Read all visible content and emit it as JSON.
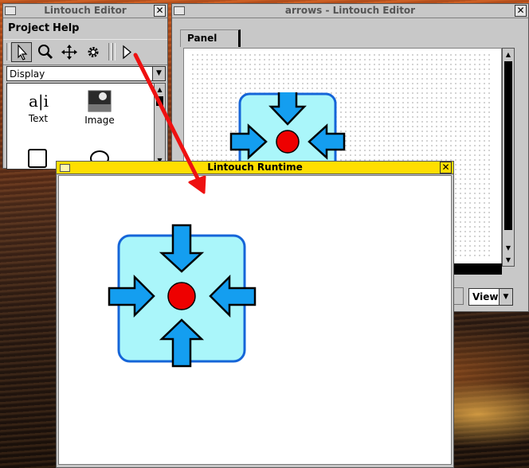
{
  "editor_window": {
    "title": "Lintouch Editor",
    "close": "✕",
    "menus": [
      "Project",
      "Help"
    ],
    "tools": [
      {
        "name": "select-tool",
        "icon": "pointer-icon"
      },
      {
        "name": "zoom-tool",
        "icon": "magnifier-icon"
      },
      {
        "name": "move-tool",
        "icon": "four-way-arrow-icon"
      },
      {
        "name": "settings-tool",
        "icon": "gear-icon"
      },
      {
        "name": "run-tool",
        "icon": "play-icon"
      }
    ],
    "palette_category": "Display",
    "palette_items": [
      {
        "label": "Text",
        "icon": "text-icon"
      },
      {
        "label": "Image",
        "icon": "image-icon"
      }
    ]
  },
  "project_window": {
    "title": "arrows - Lintouch Editor",
    "close": "✕",
    "tab": "Panel",
    "view_select": "View"
  },
  "runtime_window": {
    "title": "Lintouch Runtime",
    "close": "✕"
  },
  "colors": {
    "runtime_title": "#ffde00",
    "panel_fill": "#aaf6fa",
    "panel_border": "#1565d8",
    "arrow_fill": "#149ef0",
    "center_dot": "#ee0000",
    "annotation_arrow": "#ee1111"
  }
}
